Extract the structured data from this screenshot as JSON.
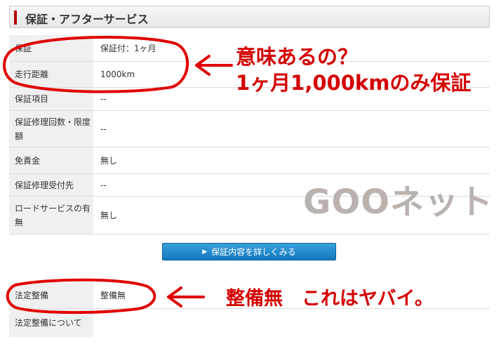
{
  "header": {
    "title": "保証・アフターサービス"
  },
  "spec_rows": [
    {
      "label": "保証",
      "value": "保証付：1ヶ月"
    },
    {
      "label": "走行距離",
      "value": "1000km"
    },
    {
      "label": "保証項目",
      "value": "--"
    },
    {
      "label": "保証修理回数・限度額",
      "value": "--"
    },
    {
      "label": "免責金",
      "value": "無し"
    },
    {
      "label": "保証修理受付先",
      "value": "--"
    },
    {
      "label": "ロードサービスの有無",
      "value": "無し"
    }
  ],
  "detail_button": {
    "label": "保証内容を詳しくみる"
  },
  "legal_rows": [
    {
      "label": "法定整備",
      "value": "整備無"
    },
    {
      "label": "法定整備について",
      "value": ""
    }
  ],
  "annotations": {
    "question": "意味あるの？",
    "warranty_note": "1ヶ月1,000kmのみ保証",
    "maintenance_note": "整備無　これはヤバイ。"
  },
  "watermark": "GOOネット",
  "colors": {
    "accent": "#b40000",
    "annotation": "#d40000",
    "button": "#1b86cc"
  }
}
